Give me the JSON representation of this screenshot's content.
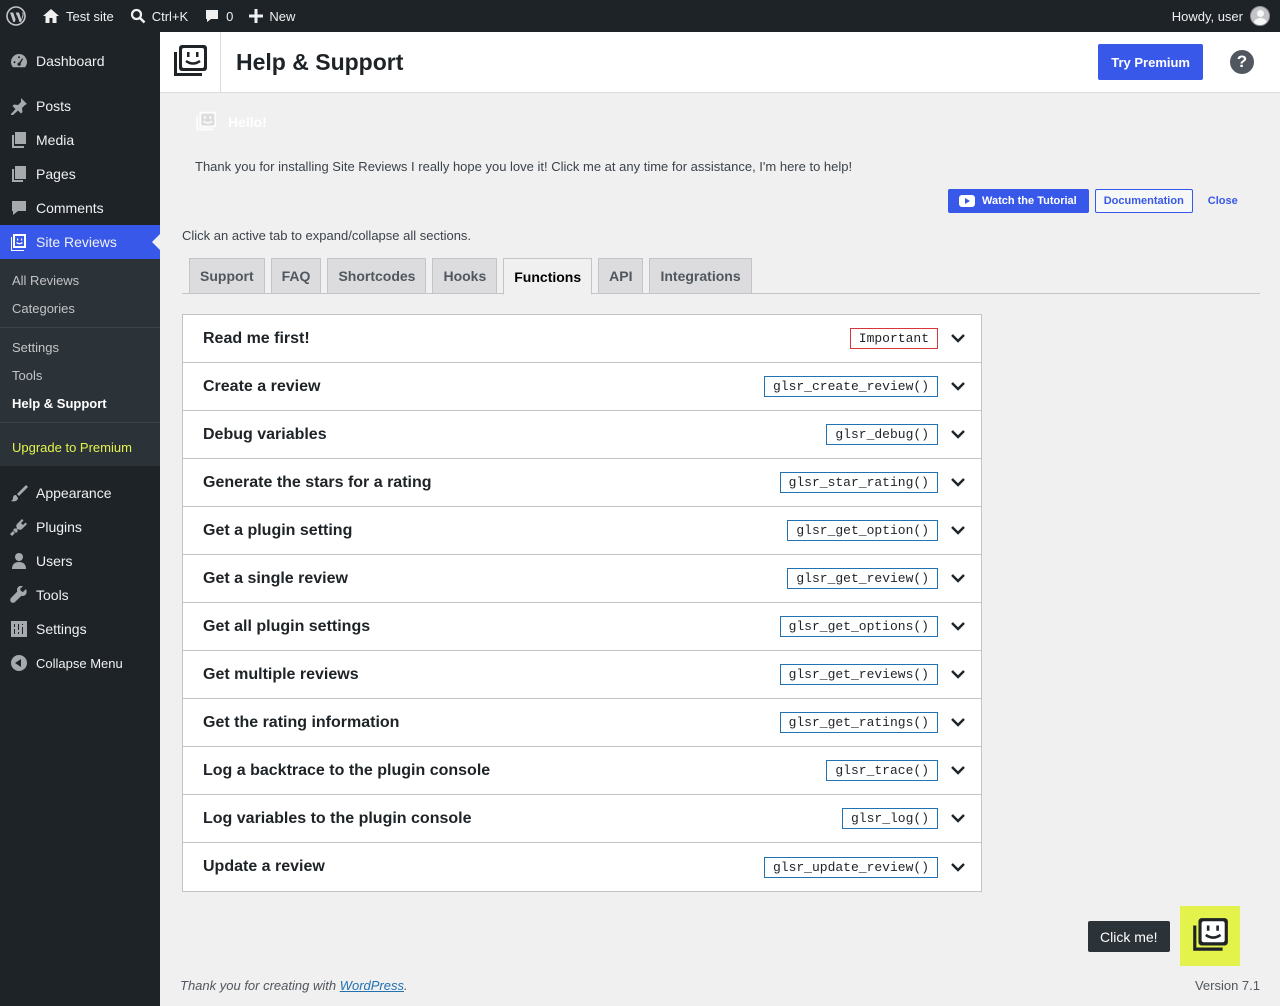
{
  "admin_bar": {
    "site_name": "Test site",
    "search_shortcut": "Ctrl+K",
    "comments_count": "0",
    "new_label": "New",
    "greeting": "Howdy, user"
  },
  "sidebar": {
    "items": [
      {
        "label": "Dashboard",
        "icon": "dashboard-icon"
      },
      {
        "label": "Posts",
        "icon": "pin-icon"
      },
      {
        "label": "Media",
        "icon": "media-icon"
      },
      {
        "label": "Pages",
        "icon": "pages-icon"
      },
      {
        "label": "Comments",
        "icon": "comment-icon"
      },
      {
        "label": "Site Reviews",
        "icon": "site-reviews-icon"
      },
      {
        "label": "Appearance",
        "icon": "brush-icon"
      },
      {
        "label": "Plugins",
        "icon": "plugin-icon"
      },
      {
        "label": "Users",
        "icon": "user-icon"
      },
      {
        "label": "Tools",
        "icon": "wrench-icon"
      },
      {
        "label": "Settings",
        "icon": "settings-icon"
      },
      {
        "label": "Collapse Menu",
        "icon": "collapse-icon"
      }
    ],
    "submenu": [
      "All Reviews",
      "Categories",
      "Settings",
      "Tools",
      "Help & Support",
      "Upgrade to Premium"
    ]
  },
  "header": {
    "title": "Help & Support",
    "try_premium": "Try Premium",
    "help": "?"
  },
  "welcome": {
    "hello": "Hello!",
    "message": "Thank you for installing Site Reviews I really hope you love it! Click me at any time for assistance, I'm here to help!",
    "tutorial_button": "Watch the Tutorial",
    "docs_button": "Documentation",
    "close_button": "Close"
  },
  "instruction": "Click an active tab to expand/collapse all sections.",
  "tabs": [
    "Support",
    "FAQ",
    "Shortcodes",
    "Hooks",
    "Functions",
    "API",
    "Integrations"
  ],
  "active_tab": "Functions",
  "sections": [
    {
      "title": "Read me first!",
      "tag": "Important"
    },
    {
      "title": "Create a review",
      "tag": "glsr_create_review()"
    },
    {
      "title": "Debug variables",
      "tag": "glsr_debug()"
    },
    {
      "title": "Generate the stars for a rating",
      "tag": "glsr_star_rating()"
    },
    {
      "title": "Get a plugin setting",
      "tag": "glsr_get_option()"
    },
    {
      "title": "Get a single review",
      "tag": "glsr_get_review()"
    },
    {
      "title": "Get all plugin settings",
      "tag": "glsr_get_options()"
    },
    {
      "title": "Get multiple reviews",
      "tag": "glsr_get_reviews()"
    },
    {
      "title": "Get the rating information",
      "tag": "glsr_get_ratings()"
    },
    {
      "title": "Log a backtrace to the plugin console",
      "tag": "glsr_trace()"
    },
    {
      "title": "Log variables to the plugin console",
      "tag": "glsr_log()"
    },
    {
      "title": "Update a review",
      "tag": "glsr_update_review()"
    }
  ],
  "click_me": "Click me!",
  "footer": {
    "thanks_prefix": "Thank you for creating with ",
    "wordpress_link": "WordPress",
    "thanks_suffix": ".",
    "version": "Version 7.1"
  },
  "colors": {
    "accent": "#3858e9",
    "admin_bg": "#1d2327",
    "highlight": "#e4f34c",
    "important_border": "#d63638"
  }
}
